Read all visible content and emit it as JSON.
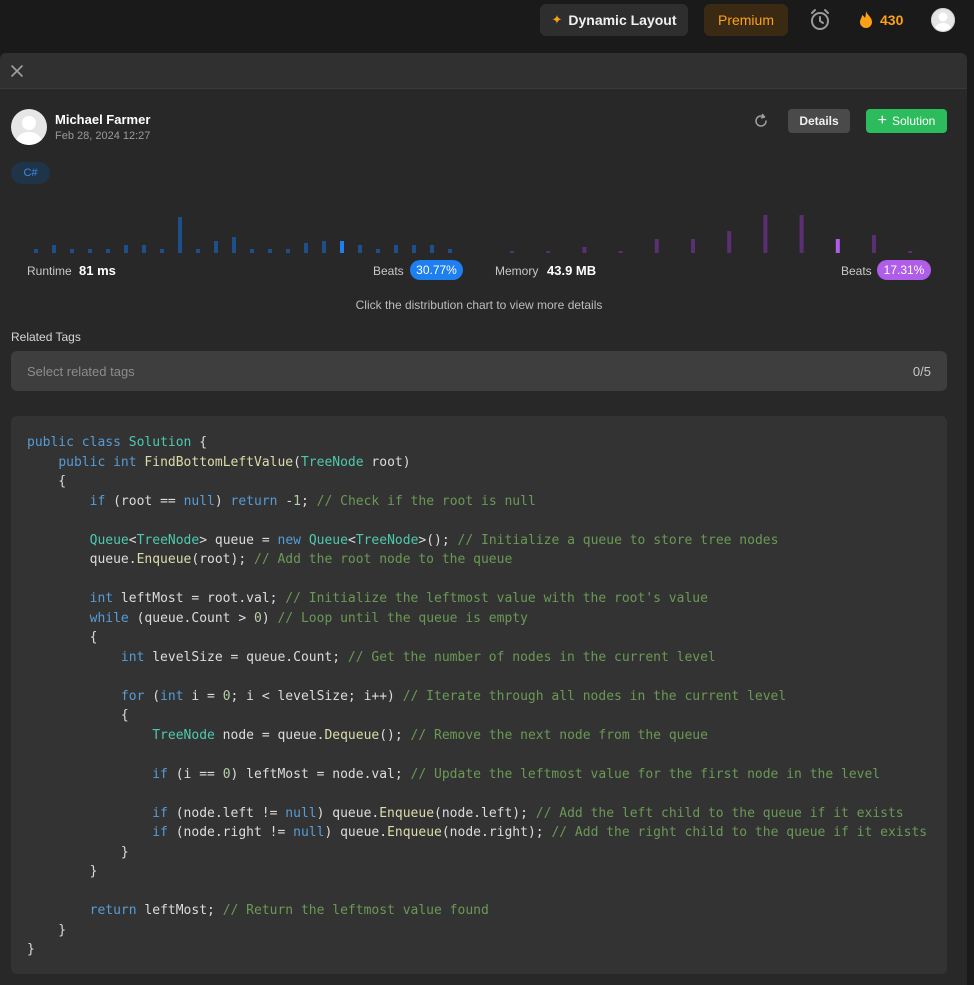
{
  "topbar": {
    "dynamic_layout_label": "Dynamic Layout",
    "premium_label": "Premium",
    "streak_count": "430"
  },
  "submission": {
    "author": "Michael Farmer",
    "date": "Feb 28, 2024 12:27",
    "details_label": "Details",
    "solution_label": "Solution",
    "language": "C#"
  },
  "stats": {
    "runtime_label": "Runtime",
    "runtime_value": "81 ms",
    "runtime_beats_label": "Beats",
    "runtime_beats_value": "30.77%",
    "memory_label": "Memory",
    "memory_value": "43.9 MB",
    "memory_beats_label": "Beats",
    "memory_beats_value": "17.31%",
    "hint": "Click the distribution chart to view more details"
  },
  "tags": {
    "label": "Related Tags",
    "placeholder": "Select related tags",
    "count": "0/5"
  },
  "colors": {
    "runtime_bar": "#1d4f8a",
    "runtime_highlight": "#1d7ff0",
    "memory_bar": "#5a2f74",
    "memory_highlight": "#b05dea",
    "accent_green": "#2cbb5d",
    "accent_orange": "#ffa116"
  },
  "chart_data": {
    "type": "bar",
    "runtime_distribution": [
      2,
      4,
      2,
      2,
      2,
      4,
      4,
      2,
      18,
      2,
      6,
      8,
      2,
      2,
      2,
      5,
      6,
      6,
      4,
      2,
      4,
      4,
      4,
      2
    ],
    "runtime_highlight_index": 17,
    "memory_distribution": [
      1,
      1,
      3,
      1,
      7,
      7,
      11,
      19,
      19,
      7,
      9,
      1
    ],
    "memory_highlight_index": 9
  },
  "code_lines": [
    "public class Solution {",
    "    public int FindBottomLeftValue(TreeNode root)",
    "    {",
    "        if (root == null) return -1; // Check if the root is null",
    "",
    "        Queue<TreeNode> queue = new Queue<TreeNode>(); // Initialize a queue to store tree nodes",
    "        queue.Enqueue(root); // Add the root node to the queue",
    "",
    "        int leftMost = root.val; // Initialize the leftmost value with the root's value",
    "        while (queue.Count > 0) // Loop until the queue is empty",
    "        {",
    "            int levelSize = queue.Count; // Get the number of nodes in the current level",
    "",
    "            for (int i = 0; i < levelSize; i++) // Iterate through all nodes in the current level",
    "            {",
    "                TreeNode node = queue.Dequeue(); // Remove the next node from the queue",
    "",
    "                if (i == 0) leftMost = node.val; // Update the leftmost value for the first node in the level",
    "",
    "                if (node.left != null) queue.Enqueue(node.left); // Add the left child to the queue if it exists",
    "                if (node.right != null) queue.Enqueue(node.right); // Add the right child to the queue if it exists",
    "            }",
    "        }",
    "",
    "        return leftMost; // Return the leftmost value found",
    "    }",
    "}"
  ]
}
